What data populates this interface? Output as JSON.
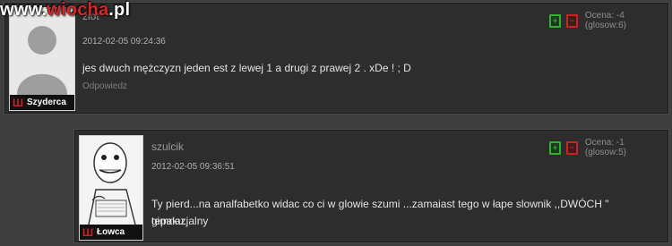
{
  "watermark": {
    "prefix": "www.",
    "accent": "wiocha",
    "suffix": ".pl"
  },
  "comments": [
    {
      "author": "zlot",
      "date": "2012-02-05 09:24:36",
      "text": "jes dwuch mężczyzn jeden est z lewej 1 a drugi z prawej 2 . xDe ! ; D",
      "reply_label": "Odpowiedz",
      "rank": "Szyderca",
      "vote_up_icon": "plus-icon",
      "vote_down_icon": "minus-icon",
      "rating": "Ocena: -4 (glosow:6)",
      "avatar": "default-user-silhouette"
    },
    {
      "author": "szulcik",
      "date": "2012-02-05 09:36:51",
      "text_line1": "Ty pierd...na analfabetko widac co ci w glowie szumi ...zamaiast tego w łape slownik ,,DWÓCH \" gimnazjalny",
      "text_line2": "tepaku.",
      "rank": "Łowca",
      "vote_up_icon": "plus-icon",
      "vote_down_icon": "minus-icon",
      "rating": "Ocena: -1 (glosow:5)",
      "avatar": "rage-comic-drawing"
    }
  ],
  "colors": {
    "page_bg": "#3e3e3e",
    "panel_bg": "#2d2d2d",
    "vote_up": "#2fb02f",
    "vote_down": "#d02020",
    "watermark_accent": "#d8252a"
  }
}
